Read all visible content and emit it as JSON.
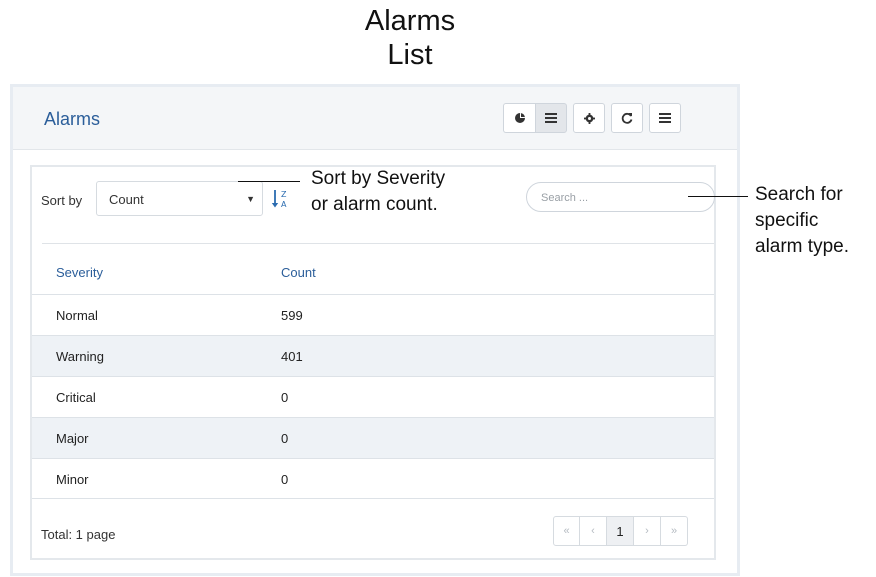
{
  "figure": {
    "title_line1": "Alarms",
    "title_line2": "List"
  },
  "widget": {
    "title": "Alarms",
    "toolbar": [
      {
        "icon": "pie-chart-icon"
      },
      {
        "icon": "list-view-icon"
      },
      {
        "icon": "gear-icon"
      },
      {
        "icon": "refresh-icon"
      },
      {
        "icon": "menu-icon"
      }
    ]
  },
  "controls": {
    "sort_label": "Sort by",
    "sort_value": "Count",
    "search_placeholder": "Search ..."
  },
  "table": {
    "columns": [
      "Severity",
      "Count"
    ],
    "rows": [
      {
        "severity": "Normal",
        "count": "599"
      },
      {
        "severity": "Warning",
        "count": "401"
      },
      {
        "severity": "Critical",
        "count": "0"
      },
      {
        "severity": "Major",
        "count": "0"
      },
      {
        "severity": "Minor",
        "count": "0"
      }
    ]
  },
  "pagination": {
    "total": "Total: 1 page",
    "first": "«",
    "prev": "‹",
    "current": "1",
    "next": "›",
    "last": "»"
  },
  "annotations": {
    "sort_line1": "Sort by Severity",
    "sort_line2": "or alarm count.",
    "search_line1": "Search for",
    "search_line2": "specific",
    "search_line3": "alarm type."
  },
  "colors": {
    "accent": "#2b5e9a",
    "alt_row": "#eef2f6"
  }
}
